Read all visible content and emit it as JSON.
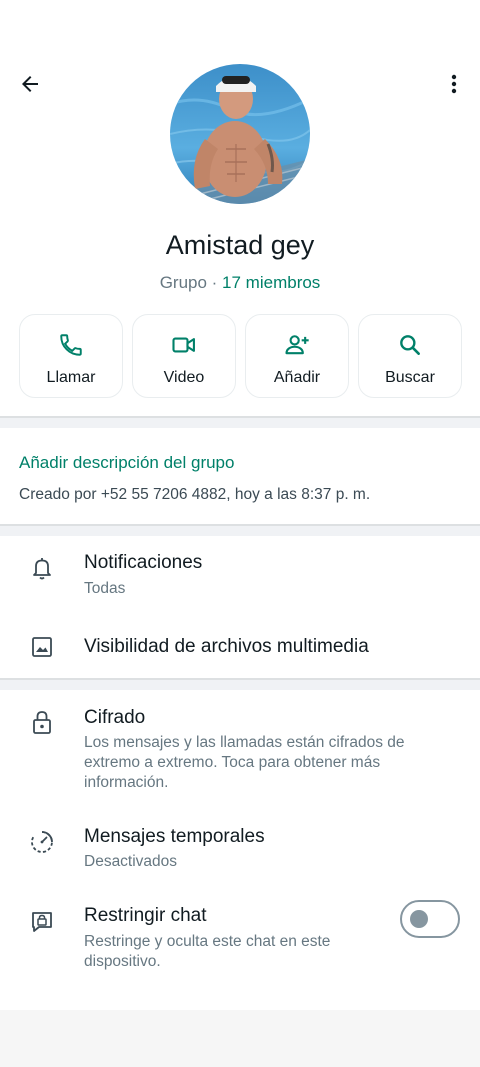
{
  "header": {
    "back_icon": "arrow-left-icon",
    "menu_icon": "more-vertical-icon"
  },
  "group": {
    "name": "Amistad gey",
    "type_label": "Grupo",
    "separator": " · ",
    "members_label": "17 miembros"
  },
  "actions": [
    {
      "label": "Llamar",
      "icon": "phone-icon"
    },
    {
      "label": "Video",
      "icon": "video-icon"
    },
    {
      "label": "Añadir",
      "icon": "add-person-icon"
    },
    {
      "label": "Buscar",
      "icon": "search-icon"
    }
  ],
  "description": {
    "add_link": "Añadir descripción del grupo",
    "created_text": "Creado por +52 55 7206 4882, hoy a las 8:37 p. m."
  },
  "settings": {
    "notifications": {
      "title": "Notificaciones",
      "value": "Todas",
      "icon": "bell-icon"
    },
    "media_visibility": {
      "title": "Visibilidad de archivos multimedia",
      "icon": "image-icon"
    },
    "encryption": {
      "title": "Cifrado",
      "description": "Los mensajes y las llamadas están cifrados de extremo a extremo. Toca para obtener más información.",
      "icon": "lock-icon"
    },
    "disappearing": {
      "title": "Mensajes temporales",
      "value": "Desactivados",
      "icon": "timer-icon"
    },
    "restrict": {
      "title": "Restringir chat",
      "description": "Restringe y oculta este chat en este dispositivo.",
      "icon": "chat-lock-icon",
      "enabled": false
    }
  },
  "colors": {
    "accent": "#008069",
    "text_primary": "#111b21",
    "text_secondary": "#667781",
    "divider_bg": "#f0f2f5"
  }
}
